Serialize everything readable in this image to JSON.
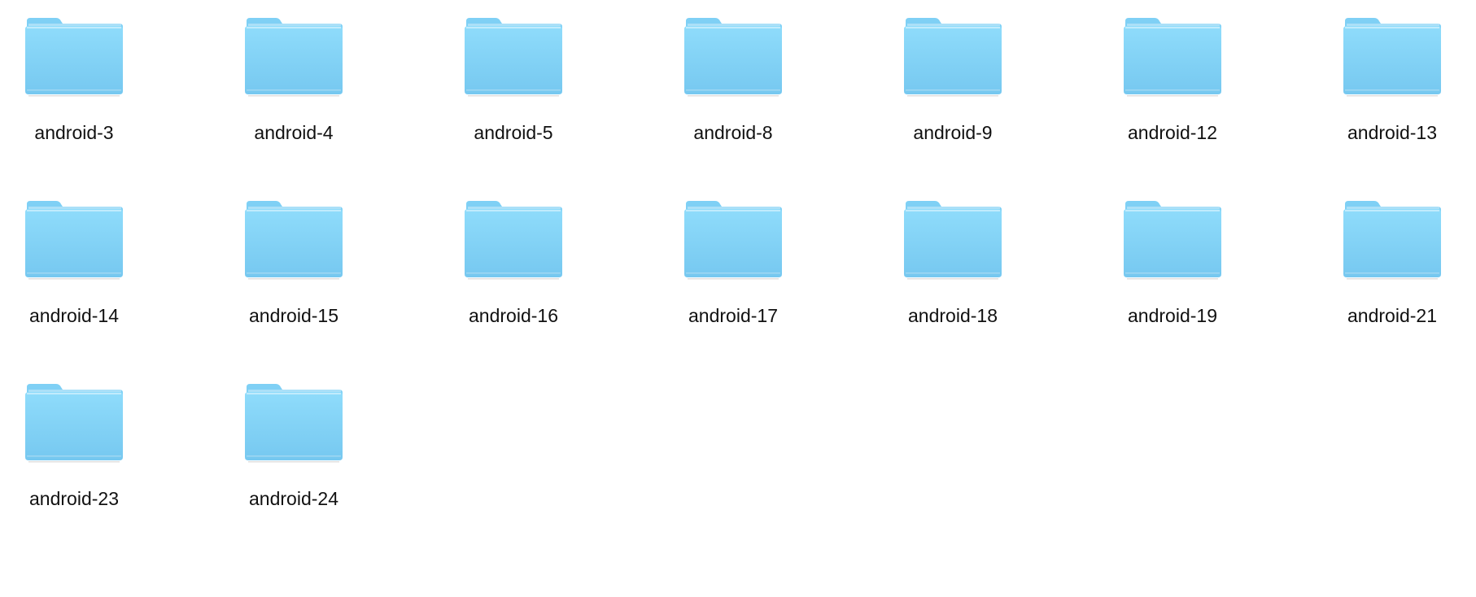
{
  "window": {
    "view": "icon-view"
  },
  "colors": {
    "folder_back": "#7fd0f5",
    "folder_front": "#8fdcfb",
    "folder_front_bottom": "#76c8f0",
    "folder_shadow": "#a9dbf2",
    "background": "#ffffff"
  },
  "folders": [
    {
      "name": "android-3",
      "icon": "folder-icon"
    },
    {
      "name": "android-4",
      "icon": "folder-icon"
    },
    {
      "name": "android-5",
      "icon": "folder-icon"
    },
    {
      "name": "android-8",
      "icon": "folder-icon"
    },
    {
      "name": "android-9",
      "icon": "folder-icon"
    },
    {
      "name": "android-12",
      "icon": "folder-icon"
    },
    {
      "name": "android-13",
      "icon": "folder-icon"
    },
    {
      "name": "android-14",
      "icon": "folder-icon"
    },
    {
      "name": "android-15",
      "icon": "folder-icon"
    },
    {
      "name": "android-16",
      "icon": "folder-icon"
    },
    {
      "name": "android-17",
      "icon": "folder-icon"
    },
    {
      "name": "android-18",
      "icon": "folder-icon"
    },
    {
      "name": "android-19",
      "icon": "folder-icon"
    },
    {
      "name": "android-21",
      "icon": "folder-icon"
    },
    {
      "name": "android-23",
      "icon": "folder-icon"
    },
    {
      "name": "android-24",
      "icon": "folder-icon"
    }
  ]
}
